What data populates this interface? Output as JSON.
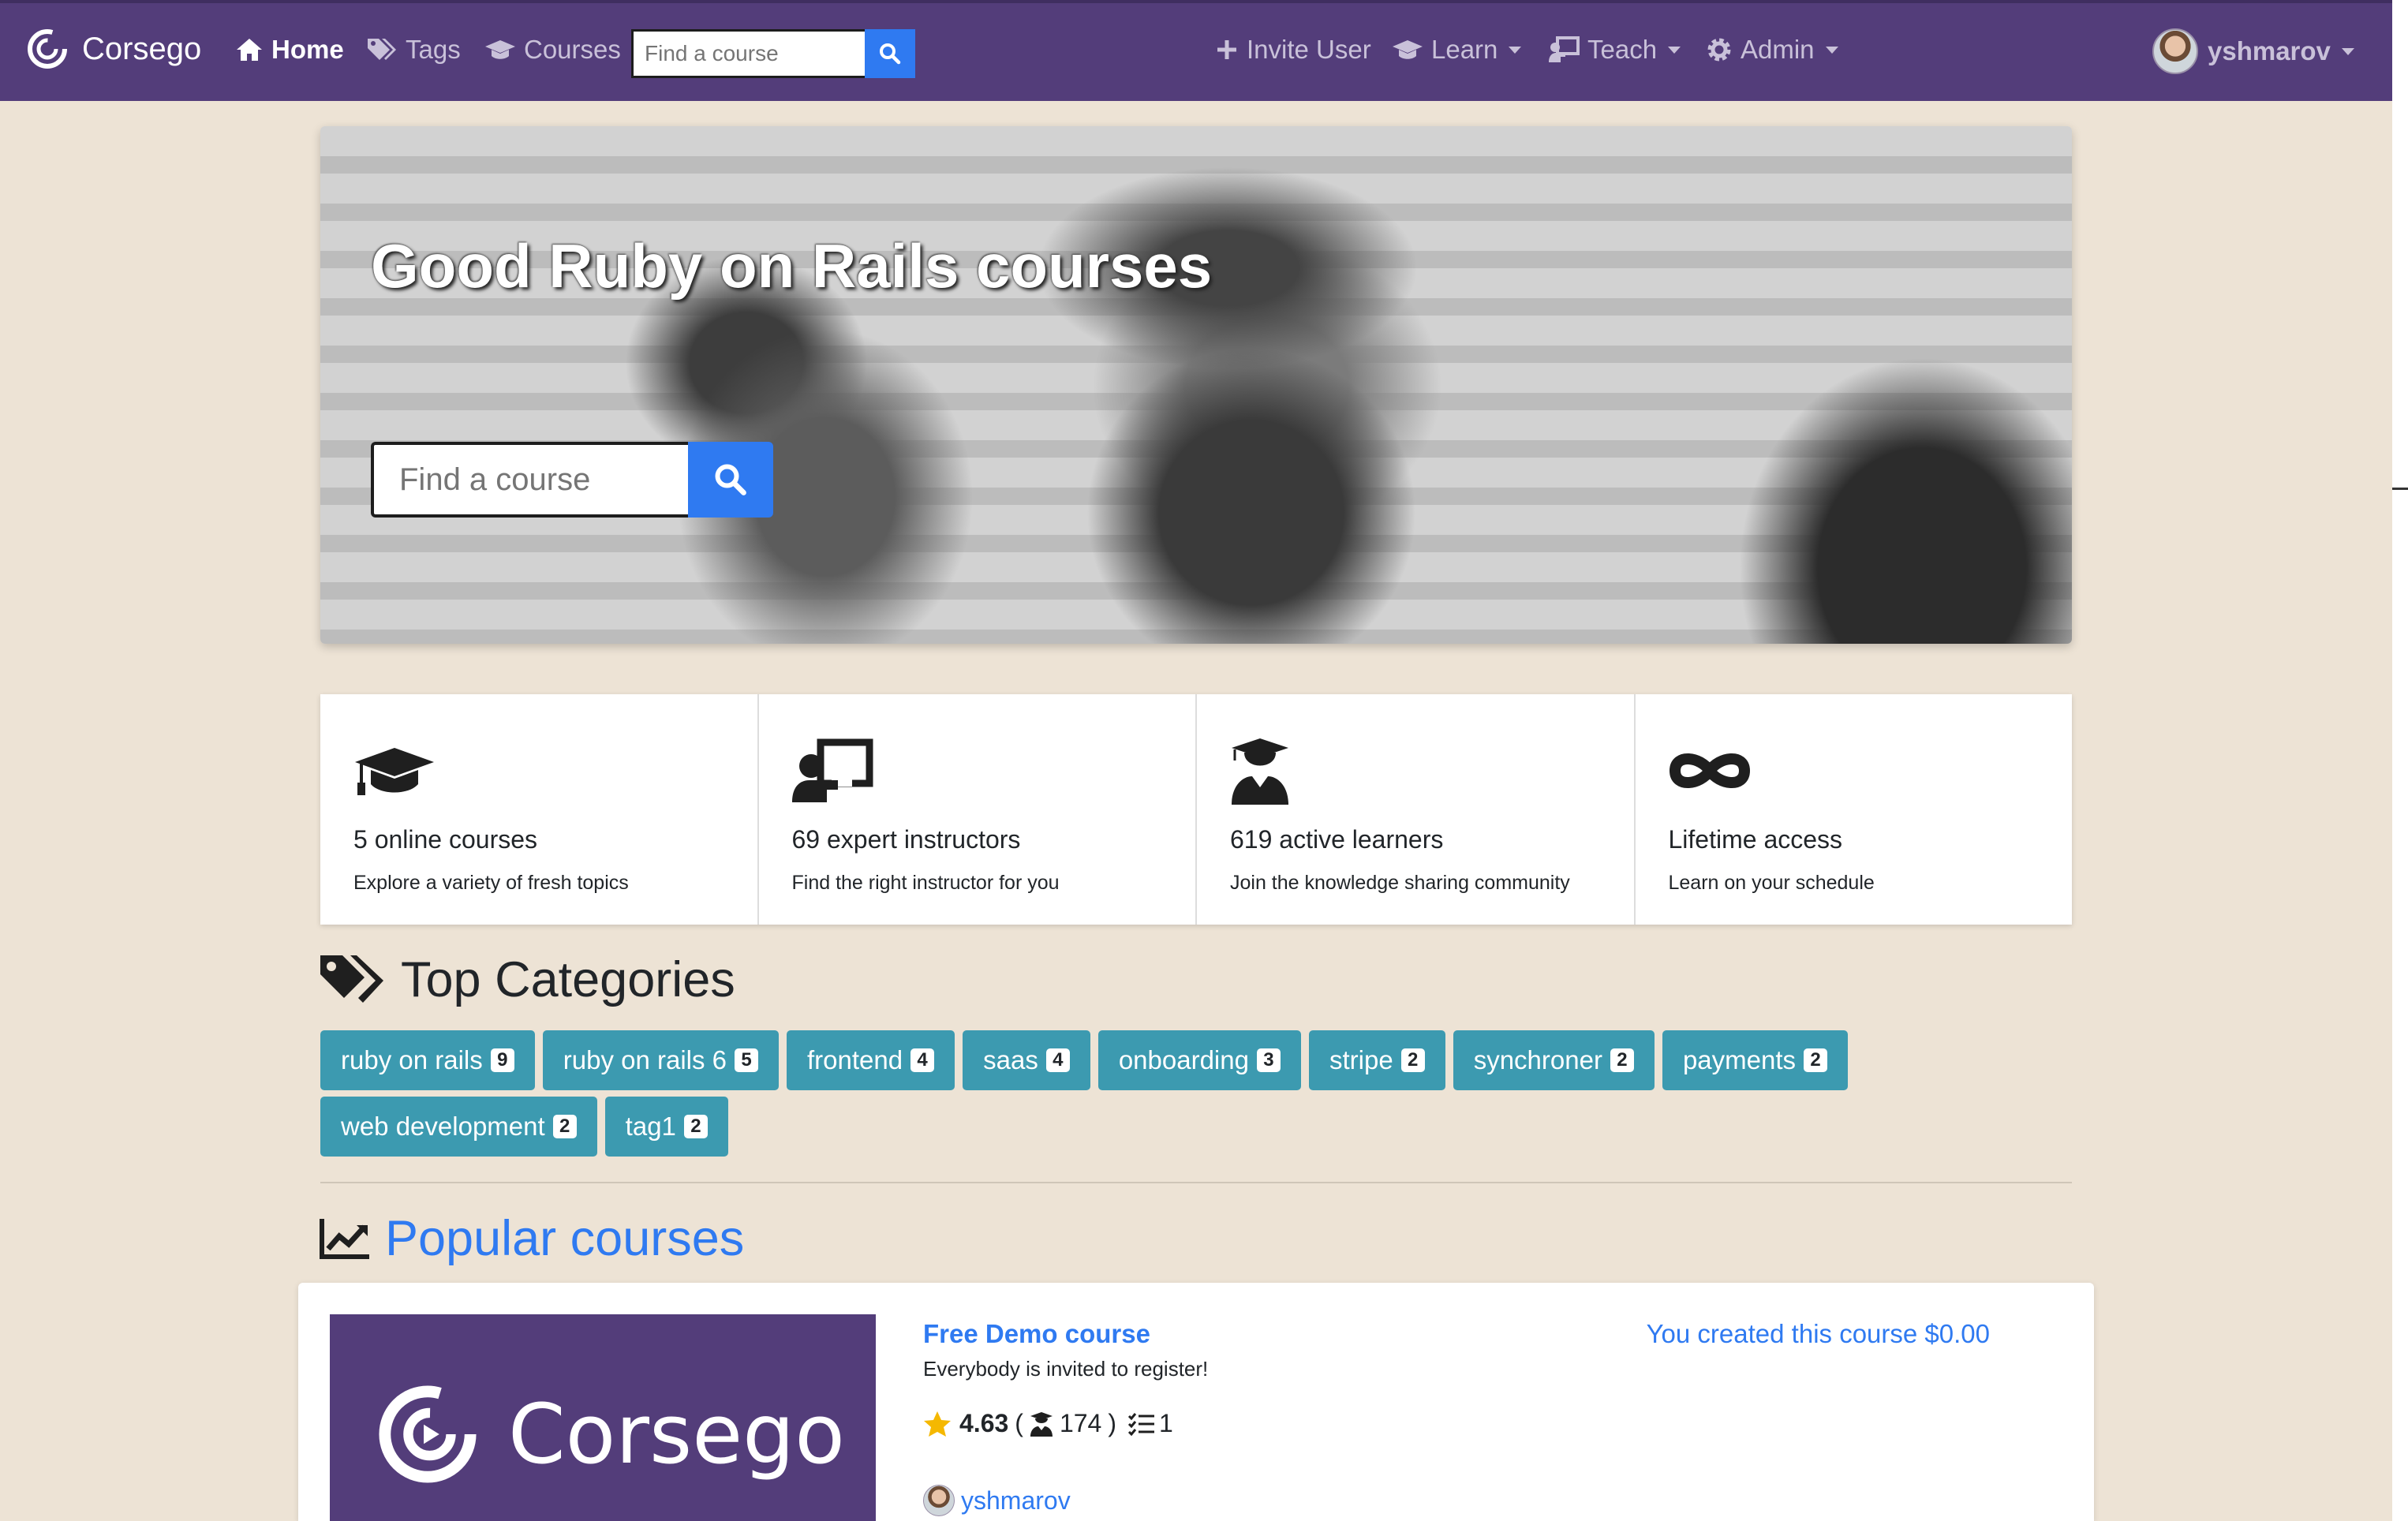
{
  "nav": {
    "brand": "Corsego",
    "home": "Home",
    "tags": "Tags",
    "courses": "Courses",
    "search_placeholder": "Find a course",
    "invite": "Invite User",
    "learn": "Learn",
    "teach": "Teach",
    "admin": "Admin",
    "username": "yshmarov"
  },
  "hero": {
    "title": "Good Ruby on Rails courses",
    "search_placeholder": "Find a course"
  },
  "features": [
    {
      "icon": "graduation-cap-icon",
      "title": "5 online courses",
      "desc": "Explore a variety of fresh topics"
    },
    {
      "icon": "chalkboard-teacher-icon",
      "title": "69 expert instructors",
      "desc": "Find the right instructor for you"
    },
    {
      "icon": "user-graduate-icon",
      "title": "619 active learners",
      "desc": "Join the knowledge sharing community"
    },
    {
      "icon": "infinity-icon",
      "title": "Lifetime access",
      "desc": "Learn on your schedule"
    }
  ],
  "categories": {
    "title": "Top Categories",
    "tags": [
      {
        "name": "ruby on rails",
        "count": "9"
      },
      {
        "name": "ruby on rails 6",
        "count": "5"
      },
      {
        "name": "frontend",
        "count": "4"
      },
      {
        "name": "saas",
        "count": "4"
      },
      {
        "name": "onboarding",
        "count": "3"
      },
      {
        "name": "stripe",
        "count": "2"
      },
      {
        "name": "synchroner",
        "count": "2"
      },
      {
        "name": "payments",
        "count": "2"
      },
      {
        "name": "web development",
        "count": "2"
      },
      {
        "name": "tag1",
        "count": "2"
      }
    ]
  },
  "popular": {
    "title": "Popular courses",
    "course": {
      "image_text": "Corsego",
      "title": "Free Demo course",
      "subtitle": "Everybody is invited to register!",
      "rating": "4.63",
      "open_paren": "(",
      "learners": "174",
      "close_paren": ")",
      "lessons": "1",
      "author": "yshmarov",
      "price": "You created this course $0.00"
    }
  },
  "colors": {
    "navbar": "#533d7a",
    "page_bg": "#ede3d5",
    "accent_blue": "#2f7af1",
    "tag_bg": "#3c9ab0",
    "star": "#f5b800"
  }
}
